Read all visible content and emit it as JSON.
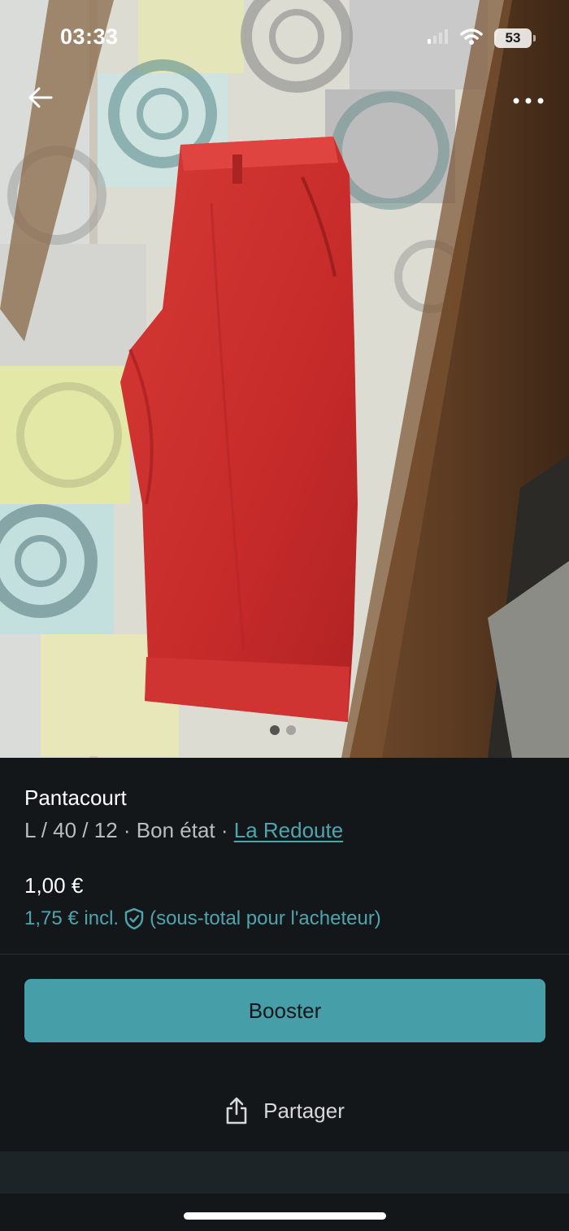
{
  "status_bar": {
    "time": "03:33",
    "battery": "53",
    "icons": [
      "signal-icon",
      "wifi-icon",
      "battery-icon"
    ]
  },
  "nav": {
    "back_icon": "arrow-left-icon",
    "more_icon": "more-horizontal-icon"
  },
  "gallery": {
    "image_count": 2,
    "active_index": 0
  },
  "item": {
    "title": "Pantacourt",
    "meta_prefix": "L / 40 / 12 · Bon état · ",
    "brand": "La Redoute",
    "price": "1,00 €",
    "price_incl_amount": "1,75 € incl.",
    "price_incl_note": "(sous-total pour l'acheteur)",
    "protection_icon": "shield-check-icon"
  },
  "actions": {
    "booster_label": "Booster",
    "share_label": "Partager",
    "share_icon": "share-icon"
  },
  "colors": {
    "background": "#13171a",
    "accent": "#469ea8",
    "link": "#4fa5ad",
    "muted_text": "#b9bdbf"
  }
}
